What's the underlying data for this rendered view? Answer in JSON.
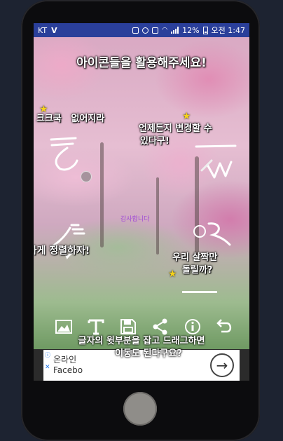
{
  "status_bar": {
    "carrier": "KT",
    "battery": "12%",
    "time": "오전 1:47"
  },
  "canvas": {
    "title": "아이콘들을 활용해주세요!",
    "notes": {
      "top_left": "크크쿡   없어지라",
      "top_right_1": "언제든지 변경할 수",
      "top_right_2": "있다구!",
      "mid_left": "깔끔하게 정렬하자!",
      "mid_right_1": "우리 살짝만",
      "mid_right_2": "돌릴까?",
      "thanks": "감사합니다",
      "bottom_1": "글자의 윗부분을 잡고 드래그하면",
      "bottom_2": "이동도 된다구요?"
    }
  },
  "toolbar": {
    "tools": [
      {
        "name": "image-icon"
      },
      {
        "name": "text-icon"
      },
      {
        "name": "save-icon"
      },
      {
        "name": "share-icon"
      },
      {
        "name": "info-icon"
      },
      {
        "name": "undo-icon"
      }
    ]
  },
  "ad": {
    "line1": "온라인",
    "line2": "Facebo"
  },
  "colors": {
    "status_bar": "#2a3f9a",
    "star": "#f5d21a",
    "thanks_text": "#a04bd6"
  }
}
